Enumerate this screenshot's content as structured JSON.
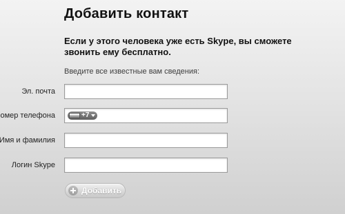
{
  "dialog": {
    "title": "Добавить контакт",
    "subtitle": "Если у этого человека уже есть Skype, вы сможете звонить ему бесплатно.",
    "instructions": "Введите все известные вам сведения:"
  },
  "form": {
    "email": {
      "label": "Эл. почта",
      "value": ""
    },
    "phone": {
      "label": "Номер телефона",
      "dial_code": "+7",
      "value": ""
    },
    "full_name": {
      "label": "Имя и фамилия",
      "value": ""
    },
    "skype_login": {
      "label": "Логин Skype",
      "value": ""
    }
  },
  "actions": {
    "add_label": "Добавить",
    "add_enabled": false
  },
  "colors": {
    "background_top": "#f3f3f3",
    "background_bottom": "#d0d0d0",
    "field_border": "#9a9a9a",
    "button_disabled": "#d9d9d9"
  },
  "icons": {
    "country_flag": "flag-icon",
    "country_chevron": "chevron-down-icon",
    "add": "plus-icon"
  }
}
